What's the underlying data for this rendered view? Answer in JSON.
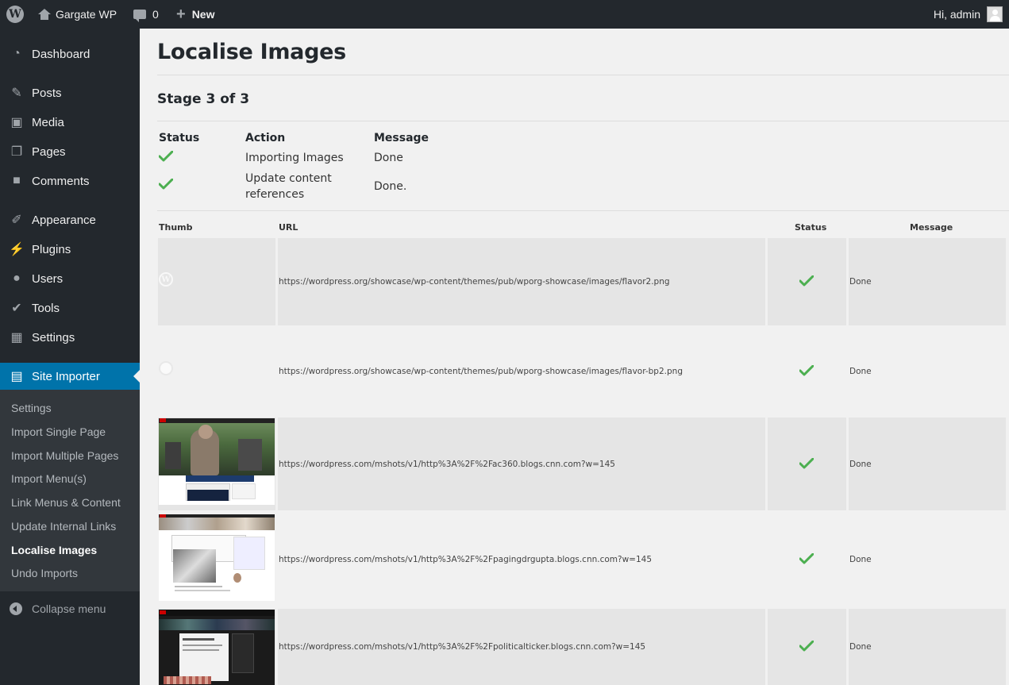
{
  "adminbar": {
    "site_name": "Gargate WP",
    "comments_count": "0",
    "new_label": "New",
    "howdy": "Hi, admin"
  },
  "sidebar": {
    "items": [
      {
        "label": "Dashboard",
        "icon": "dashboard-icon"
      },
      {
        "label": "Posts",
        "icon": "pin-icon"
      },
      {
        "label": "Media",
        "icon": "media-icon"
      },
      {
        "label": "Pages",
        "icon": "pages-icon"
      },
      {
        "label": "Comments",
        "icon": "comment-icon"
      },
      {
        "label": "Appearance",
        "icon": "brush-icon"
      },
      {
        "label": "Plugins",
        "icon": "plug-icon"
      },
      {
        "label": "Users",
        "icon": "user-icon"
      },
      {
        "label": "Tools",
        "icon": "wrench-icon"
      },
      {
        "label": "Settings",
        "icon": "settings-icon"
      },
      {
        "label": "Site Importer",
        "icon": "document-icon"
      }
    ],
    "submenu": [
      "Settings",
      "Import Single Page",
      "Import Multiple Pages",
      "Import Menu(s)",
      "Link Menus & Content",
      "Update Internal Links",
      "Localise Images",
      "Undo Imports"
    ],
    "collapse_label": "Collapse menu"
  },
  "main": {
    "title": "Localise Images",
    "stage": "Stage 3 of 3",
    "status_table": {
      "headers": [
        "Status",
        "Action",
        "Message"
      ],
      "rows": [
        {
          "action": "Importing Images",
          "message": "Done"
        },
        {
          "action_line1": "Update content",
          "action_line2": "references",
          "message": "Done."
        }
      ]
    },
    "images_table": {
      "headers": [
        "Thumb",
        "URL",
        "Status",
        "Message"
      ],
      "rows": [
        {
          "url": "https://wordpress.org/showcase/wp-content/themes/pub/wporg-showcase/images/flavor2.png",
          "message": "Done"
        },
        {
          "url": "https://wordpress.org/showcase/wp-content/themes/pub/wporg-showcase/images/flavor-bp2.png",
          "message": "Done"
        },
        {
          "url": "https://wordpress.com/mshots/v1/http%3A%2F%2Fac360.blogs.cnn.com?w=145",
          "message": "Done"
        },
        {
          "url": "https://wordpress.com/mshots/v1/http%3A%2F%2Fpagingdrgupta.blogs.cnn.com?w=145",
          "message": "Done"
        },
        {
          "url": "https://wordpress.com/mshots/v1/http%3A%2F%2Fpoliticalticker.blogs.cnn.com?w=145",
          "message": "Done"
        }
      ]
    }
  },
  "colors": {
    "admin_bar": "#23282d",
    "accent": "#0073aa",
    "check_green": "#4caf50"
  }
}
